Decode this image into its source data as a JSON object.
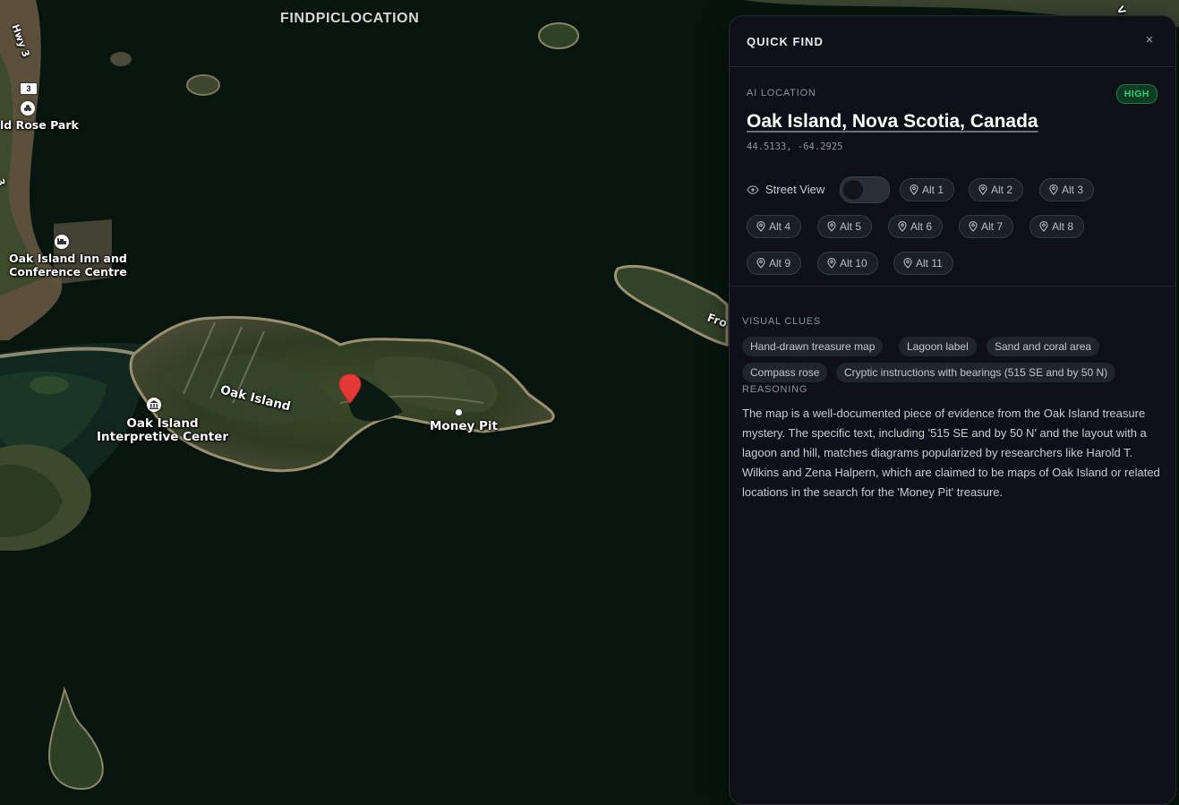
{
  "brand": "FINDPICLOCATION",
  "map": {
    "labels": {
      "wild_rose_park": "ld Rose Park",
      "inn": "Oak Island Inn and\nConference Centre",
      "oak_island": "Oak Island",
      "interpretive": "Oak Island\nInterpretive Center",
      "money_pit": "Money Pit",
      "hwy": "Hwy 3",
      "hwy_shield": "3",
      "hwy_small": "3",
      "frog": "Fro",
      "edge_v": "V"
    },
    "icons": [
      "flower-icon",
      "bed-icon",
      "museum-icon",
      "map-pin-icon"
    ]
  },
  "panel": {
    "title": "QUICK FIND",
    "close": "×",
    "ai_location_label": "AI LOCATION",
    "confidence": "HIGH",
    "location_name": "Oak Island, Nova Scotia, Canada",
    "coordinates": "44.5133, -64.2925",
    "street_view_label": "Street View",
    "street_view_on": false,
    "alts": [
      "Alt 1",
      "Alt 2",
      "Alt 3",
      "Alt 4",
      "Alt 5",
      "Alt 6",
      "Alt 7",
      "Alt 8",
      "Alt 9",
      "Alt 10",
      "Alt 11"
    ],
    "visual_clues_label": "VISUAL CLUES",
    "visual_clues": [
      "Hand-drawn treasure map",
      "Lagoon label",
      "Sand and coral area",
      "Compass rose",
      "Cryptic instructions with bearings (515 SE and by 50 N)"
    ],
    "reasoning_label": "REASONING",
    "reasoning": "The map is a well-documented piece of evidence from the Oak Island treasure mystery. The specific text, including '515 SE and by 50 N' and the layout with a lagoon and hill, matches diagrams popularized by researchers like Harold T. Wilkins and Zena Halpern, which are claimed to be maps of Oak Island or related locations in the search for the 'Money Pit' treasure."
  },
  "colors": {
    "water": "#08160f",
    "panel_bg": "#0d1017",
    "badge_text": "#36d07a",
    "pin": "#e53935"
  }
}
